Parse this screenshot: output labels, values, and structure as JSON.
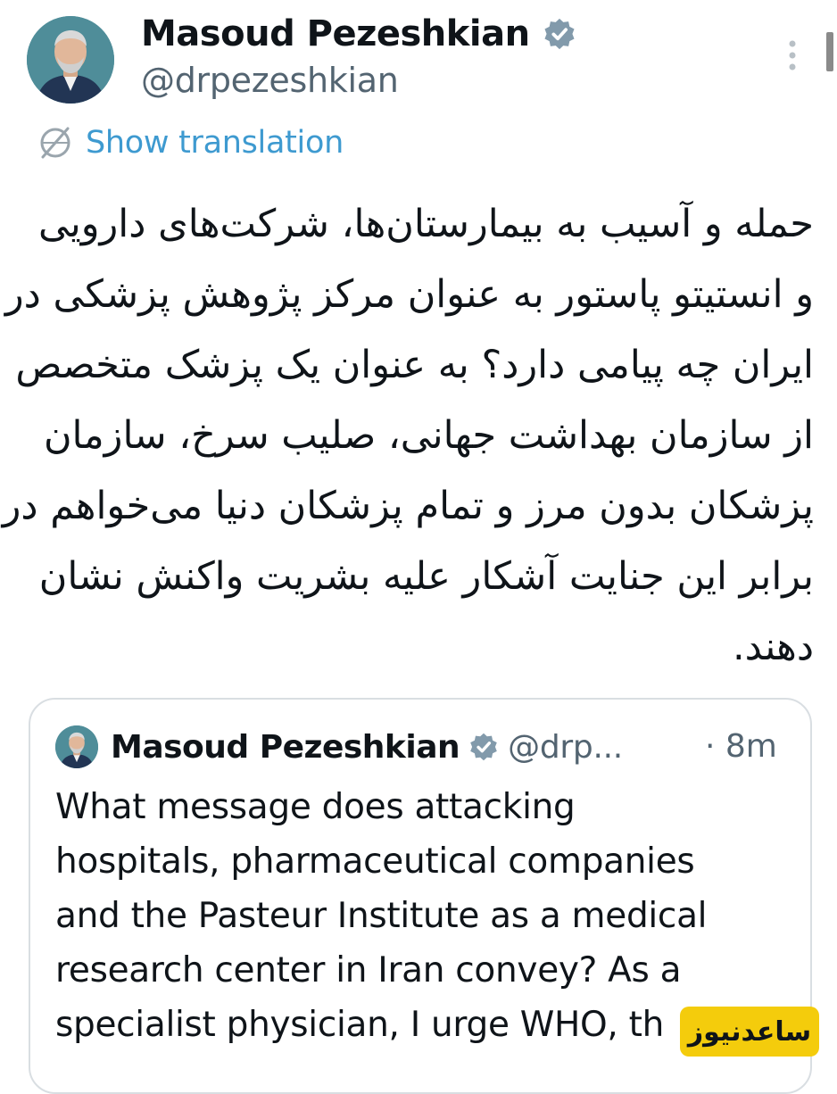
{
  "author": {
    "display_name": "Masoud Pezeshkian",
    "handle": "@drpezeshkian",
    "verified": true
  },
  "translate": {
    "icon": "globe-icon",
    "label": "Show translation"
  },
  "tweet": {
    "lines": [
      "حمله و آسیب به بیمارستان‌ها، شرکت‌های دارویی",
      "و انستیتو پاستور به عنوان مرکز پژوهش پزشکی در",
      "ایران چه پیامی دارد؟ به عنوان یک پزشک متخصص",
      "از سازمان بهداشت جهانی، صلیب سرخ، سازمان",
      "پزشکان بدون مرز و تمام پزشکان دنیا می‌خواهم در",
      "برابر این جنایت آشکار علیه بشریت واکنش نشان",
      "دهند."
    ]
  },
  "quote": {
    "display_name": "Masoud Pezeshkian",
    "handle": "@drp...",
    "time": "· 8m",
    "lines": [
      "What message does attacking",
      "hospitals, pharmaceutical companies",
      "and the Pasteur Institute as a medical",
      "research center in Iran convey? As a",
      "specialist physician, I urge WHO, th"
    ]
  },
  "watermark": {
    "text": "ساعدنیوز"
  },
  "colors": {
    "text": "#0f1419",
    "secondary": "#536471",
    "link": "#3e9ad0",
    "verified_badge": "#829aab",
    "card_border": "#d9dee2",
    "watermark_bg": "#f4cc0c"
  }
}
